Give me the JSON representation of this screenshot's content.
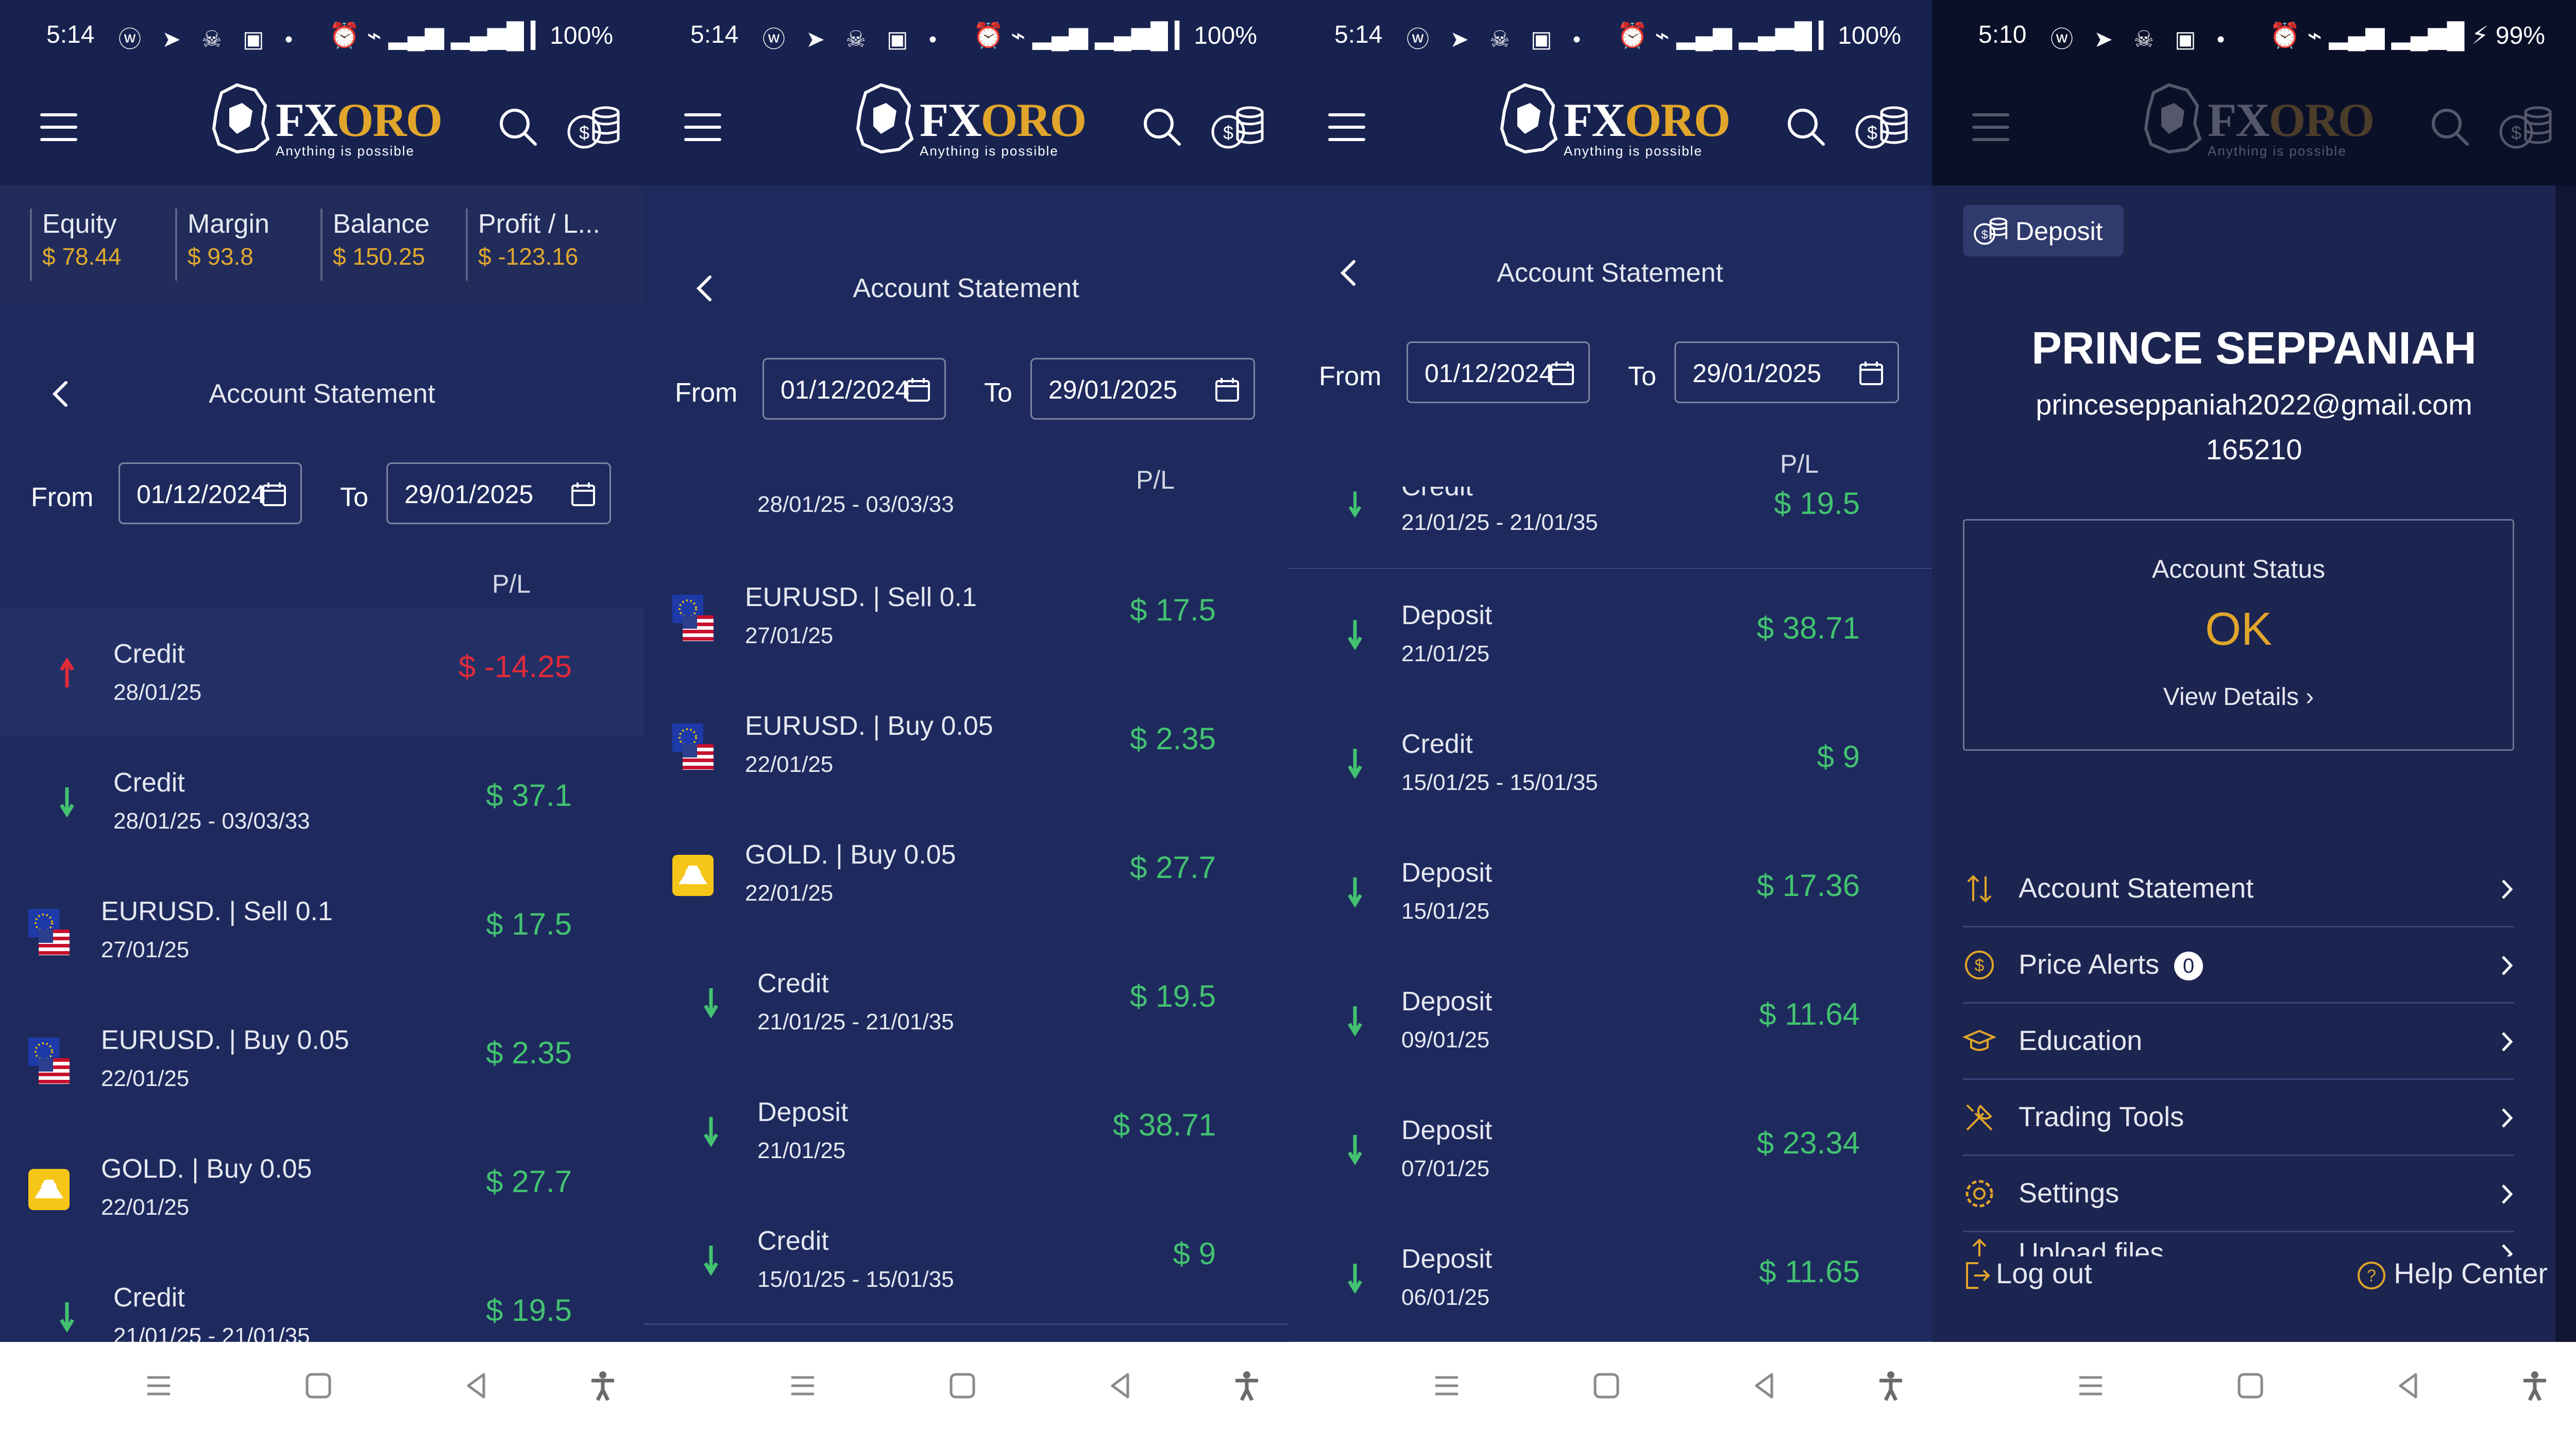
{
  "brand": {
    "name_fx": "FX",
    "name_oro": "ORO",
    "tagline": "Anything is possible"
  },
  "panels": [
    {
      "status": {
        "time": "5:14",
        "left_icons": "ⓦ ➤ ☠ ▣ •",
        "right_icons": "⏰ ⌁ ▂▄▆ ▂▄▆█ ▎100%"
      },
      "summary": [
        {
          "label": "Equity",
          "value": "$ 78.44"
        },
        {
          "label": "Margin",
          "value": "$ 93.8"
        },
        {
          "label": "Balance",
          "value": "$ 150.25"
        },
        {
          "label": "Profit / L...",
          "value": "$ -123.16"
        }
      ],
      "title": "Account Statement",
      "from_label": "From",
      "from_date": "01/12/2024",
      "to_label": "To",
      "to_date": "29/01/2025",
      "pl_header": "P/L",
      "rows": [
        {
          "kind": "credit-up",
          "title": "Credit",
          "date": "28/01/25",
          "amount": "$ -14.25",
          "sign": "neg"
        },
        {
          "kind": "credit",
          "title": "Credit",
          "date": "28/01/25 - 03/03/33",
          "amount": "$ 37.1",
          "sign": "pos"
        },
        {
          "kind": "eurusd",
          "title": "EURUSD. | Sell 0.1",
          "date": "27/01/25",
          "amount": "$ 17.5",
          "sign": "pos"
        },
        {
          "kind": "eurusd",
          "title": "EURUSD. | Buy 0.05",
          "date": "22/01/25",
          "amount": "$ 2.35",
          "sign": "pos"
        },
        {
          "kind": "gold",
          "title": "GOLD. | Buy 0.05",
          "date": "22/01/25",
          "amount": "$ 27.7",
          "sign": "pos"
        },
        {
          "kind": "credit",
          "title": "Credit",
          "date": "21/01/25 - 21/01/35",
          "amount": "$ 19.5",
          "sign": "pos"
        }
      ]
    },
    {
      "status": {
        "time": "5:14",
        "left_icons": "ⓦ ➤ ☠ ▣ •",
        "right_icons": "⏰ ⌁ ▂▄▆ ▂▄▆█ ▎100%"
      },
      "title": "Account Statement",
      "from_label": "From",
      "from_date": "01/12/2024",
      "to_label": "To",
      "to_date": "29/01/2025",
      "pl_header": "P/L",
      "partial_row_date": "28/01/25 - 03/03/33",
      "rows": [
        {
          "kind": "eurusd",
          "title": "EURUSD. | Sell 0.1",
          "date": "27/01/25",
          "amount": "$ 17.5",
          "sign": "pos"
        },
        {
          "kind": "eurusd",
          "title": "EURUSD. | Buy 0.05",
          "date": "22/01/25",
          "amount": "$ 2.35",
          "sign": "pos"
        },
        {
          "kind": "gold",
          "title": "GOLD. | Buy 0.05",
          "date": "22/01/25",
          "amount": "$ 27.7",
          "sign": "pos"
        },
        {
          "kind": "credit",
          "title": "Credit",
          "date": "21/01/25 - 21/01/35",
          "amount": "$ 19.5",
          "sign": "pos"
        },
        {
          "kind": "credit",
          "title": "Deposit",
          "date": "21/01/25",
          "amount": "$ 38.71",
          "sign": "pos"
        },
        {
          "kind": "credit",
          "title": "Credit",
          "date": "15/01/25 - 15/01/35",
          "amount": "$ 9",
          "sign": "pos"
        }
      ]
    },
    {
      "status": {
        "time": "5:14",
        "left_icons": "ⓦ ➤ ☠ ▣ •",
        "right_icons": "⏰ ⌁ ▂▄▆ ▂▄▆█ ▎100%"
      },
      "title": "Account Statement",
      "from_label": "From",
      "from_date": "01/12/2024",
      "to_label": "To",
      "to_date": "29/01/2025",
      "pl_header": "P/L",
      "partial_row": {
        "title": "Credit",
        "date": "21/01/25 - 21/01/35",
        "amount": "$ 19.5"
      },
      "rows": [
        {
          "kind": "credit",
          "title": "Deposit",
          "date": "21/01/25",
          "amount": "$ 38.71",
          "sign": "pos"
        },
        {
          "kind": "credit",
          "title": "Credit",
          "date": "15/01/25 - 15/01/35",
          "amount": "$ 9",
          "sign": "pos"
        },
        {
          "kind": "credit",
          "title": "Deposit",
          "date": "15/01/25",
          "amount": "$ 17.36",
          "sign": "pos"
        },
        {
          "kind": "credit",
          "title": "Deposit",
          "date": "09/01/25",
          "amount": "$ 11.64",
          "sign": "pos"
        },
        {
          "kind": "credit",
          "title": "Deposit",
          "date": "07/01/25",
          "amount": "$ 23.34",
          "sign": "pos"
        },
        {
          "kind": "credit",
          "title": "Deposit",
          "date": "06/01/25",
          "amount": "$ 11.65",
          "sign": "pos"
        }
      ]
    },
    {
      "status": {
        "time": "5:10",
        "left_icons": "ⓦ ➤ ☠ ▣ •",
        "right_icons": "⏰ ⌁ ▂▄▆ ▂▄▆█ ⚡ 99%"
      },
      "deposit_label": "Deposit",
      "user_name": "PRINCE SEPPANIAH",
      "user_email": "princeseppaniah2022@gmail.com",
      "user_id": "165210",
      "account_status_label": "Account Status",
      "account_status_value": "OK",
      "view_details": "View Details ›",
      "menu": [
        {
          "label": "Account Statement",
          "icon": "swap-arrows-icon"
        },
        {
          "label": "Price Alerts",
          "icon": "dollar-circle-icon",
          "badge": "0"
        },
        {
          "label": "Education",
          "icon": "graduation-cap-icon"
        },
        {
          "label": "Trading Tools",
          "icon": "tools-icon"
        },
        {
          "label": "Settings",
          "icon": "gear-icon"
        },
        {
          "label": "Upload files",
          "icon": "upload-icon"
        }
      ],
      "logout": "Log out",
      "help": "Help Center"
    }
  ],
  "colors": {
    "bg": "#1e2a5e",
    "header": "#18224f",
    "accent": "#e0a52a",
    "positive": "#43c271",
    "negative": "#e22a3a"
  }
}
